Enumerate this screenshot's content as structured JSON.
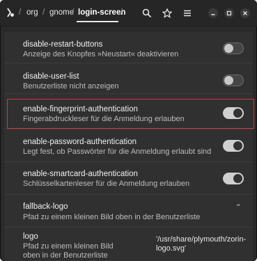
{
  "breadcrumb": {
    "items": [
      "org",
      "gnome",
      "login-screen"
    ],
    "separator": "/"
  },
  "header": {
    "icons": [
      "dconf-app-icon",
      "search-icon",
      "star-icon",
      "menu-icon",
      "minimize-icon",
      "maximize-icon",
      "close-icon"
    ]
  },
  "settings": [
    {
      "key": "disable-restart-buttons",
      "description": "Anzeige des Knopfes »Neustart« deaktivieren",
      "state": "off"
    },
    {
      "key": "disable-user-list",
      "description": "Benutzerliste nicht anzeigen",
      "state": "off"
    },
    {
      "key": "enable-fingerprint-authentication",
      "description": "Fingerabdruckleser für die Anmeldung erlauben",
      "state": "on"
    },
    {
      "key": "enable-password-authentication",
      "description": "Legt fest, ob Passwörter für die Anmeldung erlaubt sind",
      "state": "on"
    },
    {
      "key": "enable-smartcard-authentication",
      "description": "Schlüsselkartenleser für die Anmeldung erlauben",
      "state": "on"
    },
    {
      "key": "fallback-logo",
      "description": "Pfad zu einem kleinen Bild oben in der Benutzerliste",
      "value": "''"
    },
    {
      "key": "logo",
      "description_line1": "Pfad zu einem kleinen Bild",
      "description_line2": "oben in der Benutzerliste",
      "value_line1": "'/usr/share/plymouth/zorin-",
      "value_line2": "logo.svg'"
    }
  ],
  "colors": {
    "highlight": "#d23b3b",
    "background": "#2a2a2a"
  }
}
